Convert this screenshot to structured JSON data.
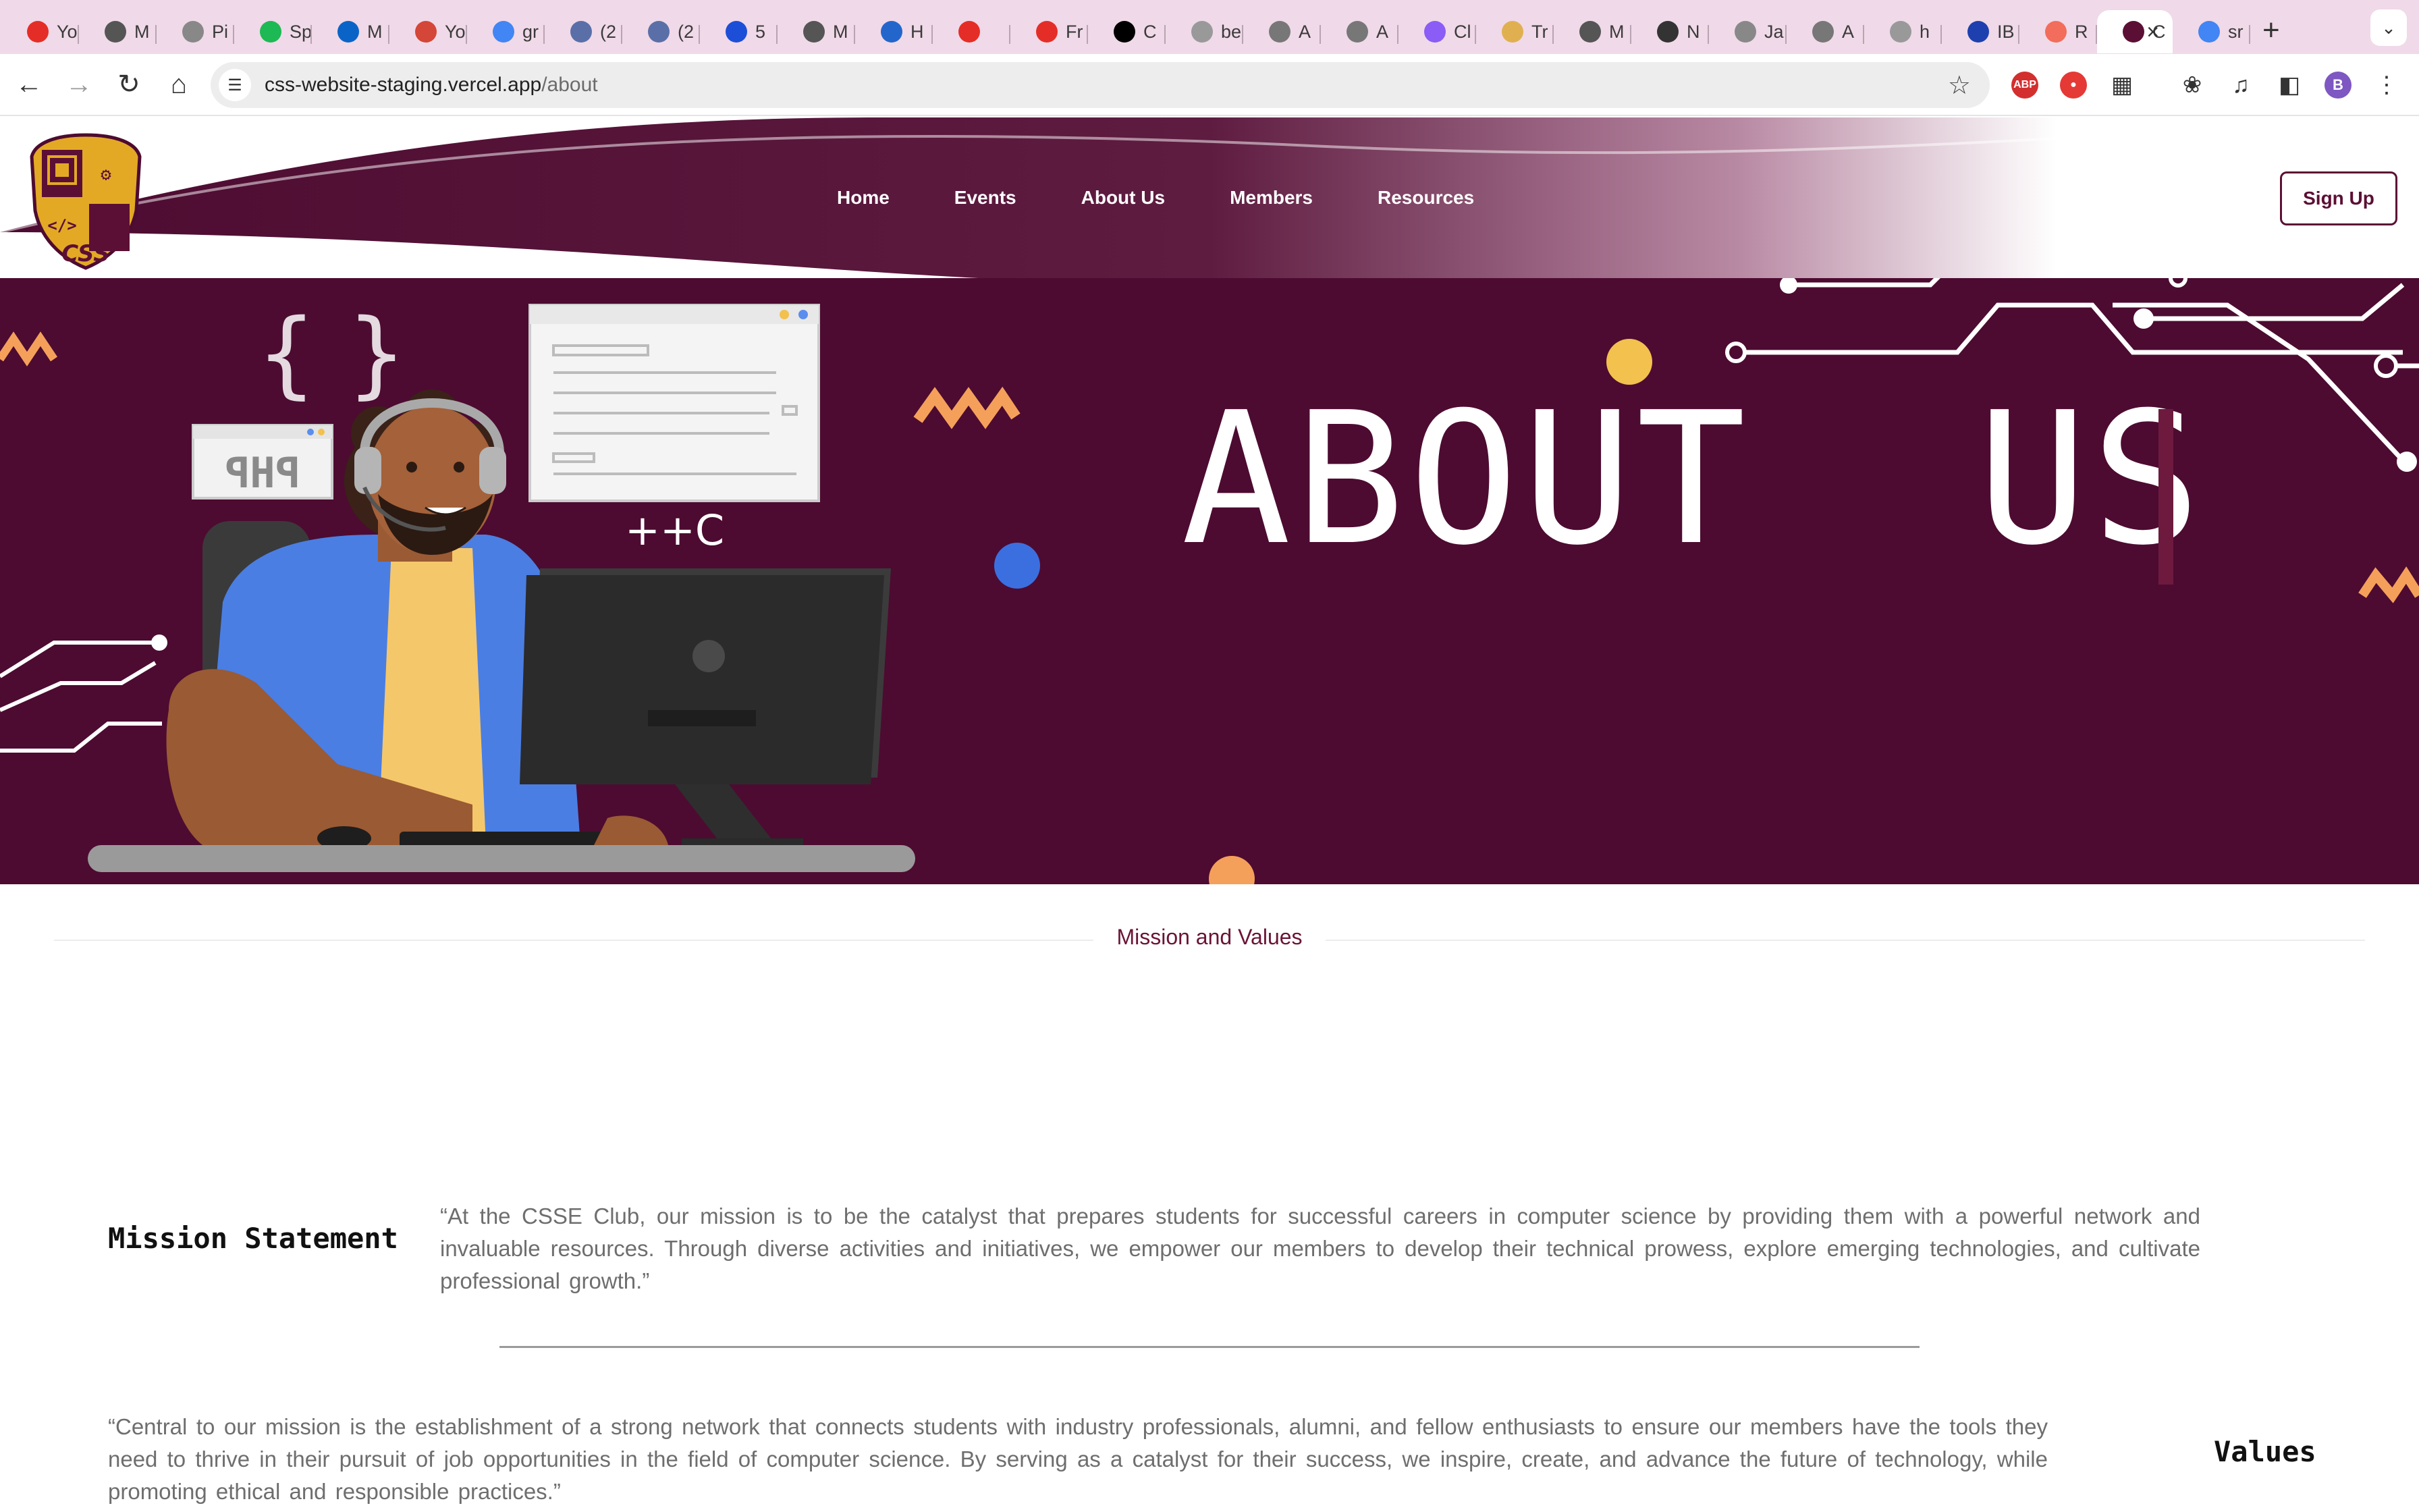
{
  "browser": {
    "tabs": [
      {
        "label": "Yo",
        "icon": "youtube-icon",
        "color": "#e52d27"
      },
      {
        "label": "M",
        "icon": "globe-icon",
        "color": "#555555"
      },
      {
        "label": "Pi",
        "icon": "chatgpt-icon",
        "color": "#888888"
      },
      {
        "label": "Sp",
        "icon": "spotify-icon",
        "color": "#1db954"
      },
      {
        "label": "M",
        "icon": "outlook-icon",
        "color": "#0a64c8"
      },
      {
        "label": "Yo",
        "icon": "gmail-icon",
        "color": "#d44638"
      },
      {
        "label": "gr",
        "icon": "google-icon",
        "color": "#4285f4"
      },
      {
        "label": "(2",
        "icon": "linkedin-icon",
        "color": "#5a6fa8"
      },
      {
        "label": "(2",
        "icon": "linkedin-icon",
        "color": "#5a6fa8"
      },
      {
        "label": "5",
        "icon": "moon-icon",
        "color": "#1d4ed8"
      },
      {
        "label": "M",
        "icon": "globe-icon",
        "color": "#555555"
      },
      {
        "label": "H",
        "icon": "x-circle-icon",
        "color": "#2266cc"
      },
      {
        "label": "",
        "icon": "youtube-icon",
        "color": "#e52d27"
      },
      {
        "label": "Fr",
        "icon": "youtube-icon",
        "color": "#e52d27"
      },
      {
        "label": "C",
        "icon": "vercel-icon",
        "color": "#000000"
      },
      {
        "label": "be",
        "icon": "google-icon",
        "color": "#999999"
      },
      {
        "label": "A",
        "icon": "amazon-icon",
        "color": "#777777"
      },
      {
        "label": "A",
        "icon": "amazon-icon",
        "color": "#777777"
      },
      {
        "label": "Cl",
        "icon": "info-icon",
        "color": "#8b5cf6"
      },
      {
        "label": "Tr",
        "icon": "smile-icon",
        "color": "#e0b050"
      },
      {
        "label": "M",
        "icon": "globe-icon",
        "color": "#555555"
      },
      {
        "label": "N",
        "icon": "github-icon",
        "color": "#333333"
      },
      {
        "label": "Ja",
        "icon": "wp-icon",
        "color": "#888888"
      },
      {
        "label": "A",
        "icon": "amazon-icon",
        "color": "#777777"
      },
      {
        "label": "h",
        "icon": "google-icon",
        "color": "#999999"
      },
      {
        "label": "IB",
        "icon": "c-icon",
        "color": "#1e40af"
      },
      {
        "label": "R",
        "icon": "fire-icon",
        "color": "#f26d5b"
      },
      {
        "label": "C",
        "icon": "css-icon",
        "color": "#5c0f34"
      },
      {
        "label": "sr",
        "icon": "google-icon",
        "color": "#4285f4"
      }
    ],
    "url_host": "css-website-staging.vercel.app",
    "url_path": "/about",
    "profile_initial": "B",
    "extensions": [
      {
        "name": "adblock-icon",
        "text": "ABP",
        "color": "#d32f2f"
      },
      {
        "name": "shield-extension-icon",
        "text": "●",
        "color": "#e53935"
      }
    ]
  },
  "site": {
    "nav": [
      "Home",
      "Events",
      "About Us",
      "Members",
      "Resources"
    ],
    "signup_label": "Sign Up",
    "logo_text": "CSS",
    "hero_title": "ABOUT  US",
    "hero_php": "PHP",
    "hero_cpp": "++C",
    "hero_braces": "{ }",
    "section_label": "Mission and Values",
    "mission_heading": "Mission Statement",
    "mission_text": "“At the CSSE Club, our mission is to be the catalyst that prepares students for successful careers in computer science by providing them with a powerful network and invaluable resources. Through diverse activities and initiatives, we empower our members to develop their technical prowess, explore emerging technologies, and cultivate professional growth.”",
    "values_heading": "Values",
    "values_text": "“Central to our mission is the establishment of a strong network that connects students with industry professionals, alumni, and fellow enthusiasts to ensure our members have the tools they need to thrive in their pursuit of job opportunities in the field of computer science. By serving as a catalyst for their success, we inspire, create, and advance the future of technology, while promoting ethical and responsible practices.”",
    "colors": {
      "maroon": "#4d0b31",
      "gold": "#f0b429",
      "orange": "#f5a05a",
      "blue_dot": "#3b6fe0",
      "yellow_dot": "#f2c14e"
    }
  }
}
